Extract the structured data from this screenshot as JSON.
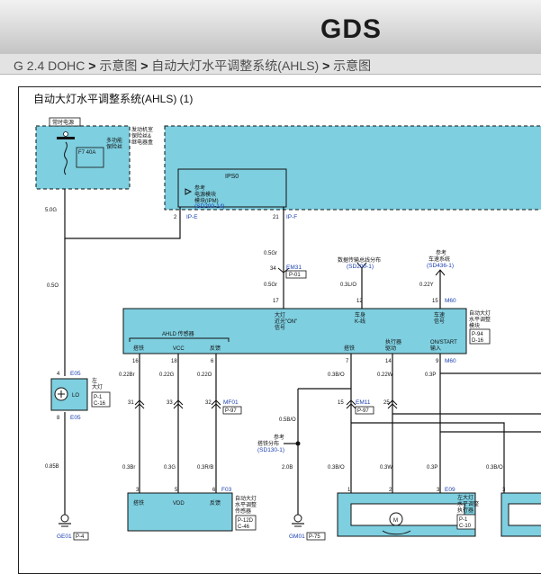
{
  "header": {
    "logo_text": "GDS",
    "brand_color": "#d7141c"
  },
  "breadcrumb": {
    "items": [
      "G 2.4 DOHC",
      "示意图",
      "自动大灯水平调整系统(AHLS)",
      "示意图"
    ],
    "separator": ">"
  },
  "diagram": {
    "title": "自动大灯水平调整系统(AHLS) (1)",
    "colors": {
      "module_fill": "#7ecfe0",
      "wire": "#111111",
      "link": "#1a3fb0"
    },
    "fuse_box": {
      "label_tag": "常时电源",
      "desc_lines": [
        "发动机室",
        "保险丝&",
        "继电器盒"
      ],
      "sublabel_lines": [
        "多功能",
        "保险丝"
      ],
      "fuse_rating": "F7 40A"
    },
    "ips0": {
      "label": "IPS0",
      "ref_lines": [
        "参考",
        "电源模块",
        "模块(IPM)"
      ],
      "ref_code": "(SD200-14)"
    },
    "wires": {
      "w_5_0G": "5.0G",
      "w_0_5O": "0.5O",
      "w_0_85B": "0.85B",
      "w_0_5Gr_a": "0.5Gr",
      "w_0_5Gr_b": "0.5Gr",
      "w_0_3L_O": "0.3L/O",
      "w_0_22Y": "0.22Y",
      "w_0_22Br": "0.22Br",
      "w_0_22G": "0.22G",
      "w_0_22O": "0.22O",
      "w_0_3B_O_a": "0.3B/O",
      "w_0_22W": "0.22W",
      "w_0_3P_a": "0.3P",
      "w_0_5B_O": "0.5B/O",
      "w_2_0B": "2.0B",
      "w_0_3Br": "0.3Br",
      "w_0_3G": "0.3G",
      "w_0_3R_B": "0.3R/B",
      "w_0_3B_O_b": "0.3B/O",
      "w_0_3W": "0.3W",
      "w_0_3P_b": "0.3P",
      "w_0_3B_O_c": "0.3B/O"
    },
    "connectors": {
      "ip_e": "IP-E",
      "ip_f": "IP-F",
      "em31": "EM31",
      "em31_ref": "P-01",
      "m60_a": "M60",
      "m60_b": "M60",
      "e05_a": "E05",
      "e05_b": "E05",
      "mf01": "MF01",
      "mf01_ref": "P-97",
      "em11": "EM11",
      "em11_ref": "P-97",
      "f03": "F03",
      "e09": "E09"
    },
    "pins": {
      "p2": "2",
      "p21": "21",
      "p34": "34",
      "p17": "17",
      "p12": "12",
      "p15": "15",
      "p16": "16",
      "p18": "18",
      "p6": "6",
      "p7": "7",
      "p14": "14",
      "p9": "9",
      "p4": "4",
      "p8": "8",
      "p31": "31",
      "p33": "33",
      "p32": "32",
      "p15b": "15",
      "p25": "25",
      "p3": "3",
      "p5": "5",
      "p6b": "6",
      "p1": "1",
      "p2b": "2",
      "p3b": "3",
      "p3c": "3"
    },
    "refs": {
      "ref_can_lines": [
        "参考",
        "数据传输总线分布"
      ],
      "ref_can_code": "(SD200-1)",
      "ref_speed_lines": [
        "参考",
        "车速系统"
      ],
      "ref_speed_code": "(SD436-1)",
      "ref_gnd_lines": [
        "参考",
        "搭铁分布"
      ],
      "ref_gnd_code": "(SD130-1)"
    },
    "ahls_module": {
      "in1_lines": [
        "大灯",
        "近光\"ON\"",
        "信号"
      ],
      "in2_lines": [
        "车身",
        "K-线"
      ],
      "in3_lines": [
        "车速",
        "信号"
      ],
      "name_lines": [
        "自动大灯",
        "水平调整",
        "模块"
      ],
      "ref1": "P-94",
      "ref2": "D-16",
      "sensor_group": "AHLD 传感器",
      "pin_sensor_gnd": "搭铁",
      "pin_vcc": "VCC",
      "pin_feedback": "反馈",
      "pin_gnd": "搭铁",
      "pin_actuator_lines": [
        "执行器",
        "驱动"
      ],
      "pin_on_start_lines": [
        "ON/START",
        "输入"
      ]
    },
    "lamp": {
      "sym": "LO",
      "label_lines": [
        "左",
        "大灯"
      ],
      "ref1": "P-1",
      "ref2": "C-16"
    },
    "sensor": {
      "pin_gnd": "搭铁",
      "pin_vdd": "VDD",
      "pin_feedback": "反馈",
      "name_lines": [
        "自动大灯",
        "水平调整",
        "传感器"
      ],
      "ref1": "P-12D",
      "ref2": "C-46"
    },
    "actuator": {
      "sym": "M",
      "name_lines": [
        "左大灯",
        "水平调整",
        "执行器"
      ],
      "ref1": "P-1",
      "ref2": "C-10"
    },
    "grounds": {
      "ge01": "GE01",
      "ge01_ref": "P-4",
      "gm01": "GM01",
      "gm01_ref": "P-75"
    }
  }
}
